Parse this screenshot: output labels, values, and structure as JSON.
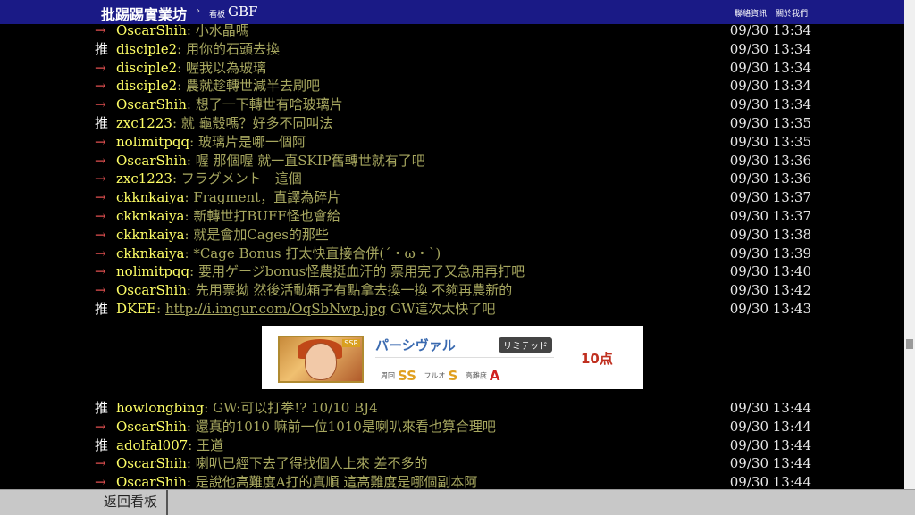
{
  "header": {
    "site_title": "批踢踢實業坊",
    "separator": "›",
    "board_label": "看板",
    "board_name": "GBF",
    "links": [
      "聯絡資訊",
      "關於我們"
    ]
  },
  "comments_top": [
    {
      "tag": "→",
      "user": "OscarShih",
      "msg": ": 小水晶嗎",
      "time": "09/30 13:34"
    },
    {
      "tag": "推",
      "user": "disciple2",
      "msg": ": 用你的石頭去換",
      "time": "09/30 13:34"
    },
    {
      "tag": "→",
      "user": "disciple2",
      "msg": ": 喔我以為玻璃",
      "time": "09/30 13:34"
    },
    {
      "tag": "→",
      "user": "disciple2",
      "msg": ": 農就趁轉世減半去刷吧",
      "time": "09/30 13:34"
    },
    {
      "tag": "→",
      "user": "OscarShih",
      "msg": ": 想了一下轉世有啥玻璃片",
      "time": "09/30 13:34"
    },
    {
      "tag": "推",
      "user": "zxc1223",
      "msg": ": 就 龜殼嗎？好多不同叫法",
      "time": "09/30 13:35"
    },
    {
      "tag": "→",
      "user": "nolimitpqq",
      "msg": ": 玻璃片是哪一個阿",
      "time": "09/30 13:35"
    },
    {
      "tag": "→",
      "user": "OscarShih",
      "msg": ": 喔 那個喔 就一直SKIP舊轉世就有了吧",
      "time": "09/30 13:36"
    },
    {
      "tag": "→",
      "user": "zxc1223",
      "msg": ": フラグメント　這個",
      "time": "09/30 13:36"
    },
    {
      "tag": "→",
      "user": "ckknkaiya",
      "msg": ": Fragment，直譯為碎片",
      "time": "09/30 13:37"
    },
    {
      "tag": "→",
      "user": "ckknkaiya",
      "msg": ": 新轉世打BUFF怪也會給",
      "time": "09/30 13:37"
    },
    {
      "tag": "→",
      "user": "ckknkaiya",
      "msg": ": 就是會加Cages的那些",
      "time": "09/30 13:38"
    },
    {
      "tag": "→",
      "user": "ckknkaiya",
      "msg": ": *Cage Bonus 打太快直接合併(´・ω・`)",
      "time": "09/30 13:39"
    },
    {
      "tag": "→",
      "user": "nolimitpqq",
      "msg": ": 要用ゲージbonus怪農挺血汗的 票用完了又急用再打吧",
      "time": "09/30 13:40"
    },
    {
      "tag": "→",
      "user": "OscarShih",
      "msg": ": 先用票拗 然後活動箱子有點拿去換一換 不夠再農新的",
      "time": "09/30 13:42"
    },
    {
      "tag": "推",
      "user": "DKEE",
      "msg": ": ",
      "link": "http://i.imgur.com/OqSbNwp.jpg",
      "msg_after": " GW這次太快了吧",
      "time": "09/30 13:43"
    }
  ],
  "embedded_image": {
    "name": "パーシヴァル",
    "rarity": "SSR",
    "badge": "リミテッド",
    "points": "10点",
    "stat1_label": "周回",
    "stat1_grade": "SS",
    "stat2_label": "フルオ",
    "stat2_grade": "S",
    "stat3_label": "高難度",
    "stat3_grade": "A"
  },
  "comments_bottom": [
    {
      "tag": "推",
      "user": "howlongbing",
      "msg": ": GW:可以打拳!? 10/10 BJ4",
      "time": "09/30 13:44"
    },
    {
      "tag": "→",
      "user": "OscarShih",
      "msg": ": 還真的1010 嘛前一位1010是喇叭來看也算合理吧",
      "time": "09/30 13:44"
    },
    {
      "tag": "推",
      "user": "adolfal007",
      "msg": ": 王道",
      "time": "09/30 13:44"
    },
    {
      "tag": "→",
      "user": "OscarShih",
      "msg": ": 喇叭已經下去了得找個人上來 差不多的",
      "time": "09/30 13:44"
    },
    {
      "tag": "→",
      "user": "OscarShih",
      "msg": ": 是說他高難度A打的真順 這高難度是哪個副本阿",
      "time": "09/30 13:44"
    }
  ],
  "footer": {
    "back_label": "返回看板"
  },
  "colors": {
    "header_bg": "#1a1a86",
    "arrow": "#e05050",
    "user": "#ffff66",
    "msg": "#a8a860"
  }
}
